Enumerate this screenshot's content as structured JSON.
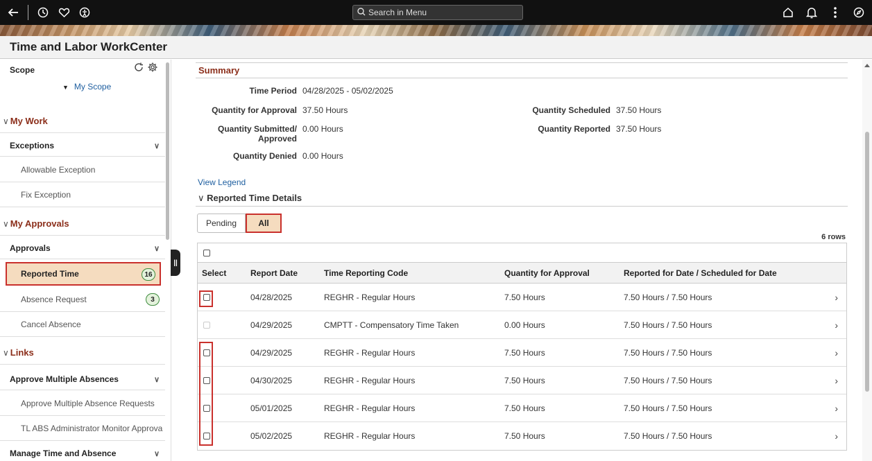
{
  "topbar": {
    "search_placeholder": "Search in Menu",
    "icons": [
      "back-arrow-icon",
      "history-icon",
      "favorites-icon",
      "accessibility-icon",
      "home-icon",
      "notifications-icon",
      "actions-menu-icon",
      "navigator-icon"
    ]
  },
  "page": {
    "title": "Time and Labor WorkCenter"
  },
  "sidebar": {
    "scope_label": "Scope",
    "my_scope": "My Scope",
    "my_work": "My Work",
    "exceptions_group": "Exceptions",
    "exceptions_items": [
      "Allowable Exception",
      "Fix Exception"
    ],
    "my_approvals": "My Approvals",
    "approvals_group": "Approvals",
    "approvals_items": [
      {
        "label": "Reported Time",
        "count": "16"
      },
      {
        "label": "Absence Request",
        "count": "3"
      },
      {
        "label": "Cancel Absence"
      }
    ],
    "links": "Links",
    "approve_multiple_group": "Approve Multiple Absences",
    "approve_multiple_items": [
      "Approve Multiple Absence Requests",
      "TL ABS Administrator Monitor Approva"
    ],
    "manage_group": "Manage Time and Absence"
  },
  "summary": {
    "title": "Summary",
    "time_period_label": "Time Period",
    "time_period_value": "04/28/2025 - 05/02/2025",
    "qty_for_approval_label": "Quantity for Approval",
    "qty_for_approval_value": "37.50 Hours",
    "qty_submitted_label_1": "Quantity Submitted/",
    "qty_submitted_label_2": "Approved",
    "qty_submitted_value": "0.00 Hours",
    "qty_denied_label": "Quantity Denied",
    "qty_denied_value": "0.00 Hours",
    "qty_scheduled_label": "Quantity Scheduled",
    "qty_scheduled_value": "37.50 Hours",
    "qty_reported_label": "Quantity Reported",
    "qty_reported_value": "37.50 Hours"
  },
  "details": {
    "view_legend": "View Legend",
    "section_title": "Reported Time Details",
    "filters": {
      "pending": "Pending",
      "all": "All"
    },
    "rows_count": "6 rows",
    "columns": {
      "select": "Select",
      "report_date": "Report Date",
      "trc": "Time Reporting Code",
      "qty": "Quantity for Approval",
      "reported": "Reported for Date / Scheduled for Date"
    },
    "rows": [
      {
        "date": "04/28/2025",
        "trc": "REGHR - Regular Hours",
        "qty": "7.50 Hours",
        "reported": "7.50 Hours / 7.50 Hours"
      },
      {
        "date": "04/29/2025",
        "trc": "CMPTT - Compensatory Time Taken",
        "qty": "0.00 Hours",
        "reported": "7.50 Hours / 7.50 Hours"
      },
      {
        "date": "04/29/2025",
        "trc": "REGHR - Regular Hours",
        "qty": "7.50 Hours",
        "reported": "7.50 Hours / 7.50 Hours"
      },
      {
        "date": "04/30/2025",
        "trc": "REGHR - Regular Hours",
        "qty": "7.50 Hours",
        "reported": "7.50 Hours / 7.50 Hours"
      },
      {
        "date": "05/01/2025",
        "trc": "REGHR - Regular Hours",
        "qty": "7.50 Hours",
        "reported": "7.50 Hours / 7.50 Hours"
      },
      {
        "date": "05/02/2025",
        "trc": "REGHR - Regular Hours",
        "qty": "7.50 Hours",
        "reported": "7.50 Hours / 7.50 Hours"
      }
    ]
  },
  "colors": {
    "accent_red": "#c9302c",
    "section_brown": "#8b2e1a",
    "link_blue": "#1f5fa0",
    "active_bg": "#f5dcbf",
    "badge_green": "#3d8b3d"
  }
}
